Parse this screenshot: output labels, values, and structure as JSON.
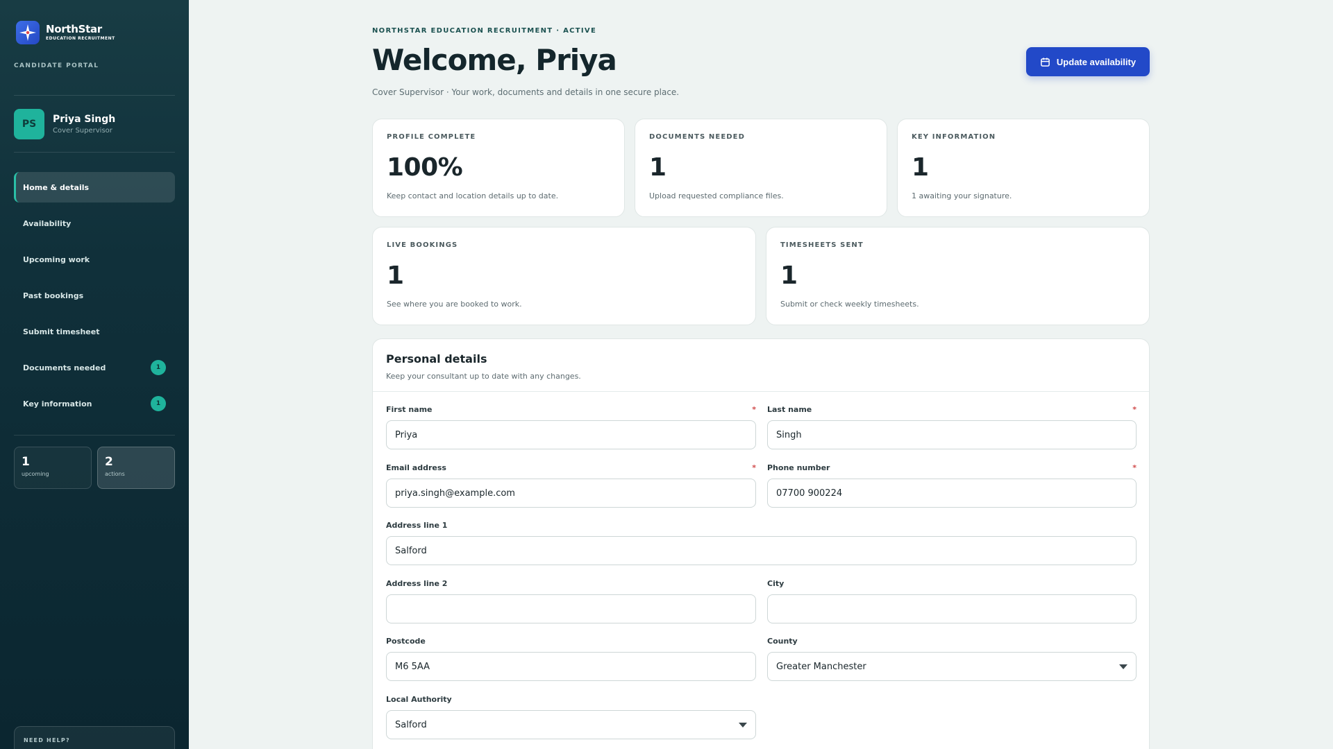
{
  "brand": {
    "name": "NorthStar",
    "sub": "EDUCATION RECRUITMENT"
  },
  "sidebar": {
    "portal_label": "CANDIDATE PORTAL",
    "profile": {
      "initials": "PS",
      "name": "Priya Singh",
      "role": "Cover Supervisor"
    },
    "nav": [
      {
        "label": "Home & details",
        "active": true,
        "badge": ""
      },
      {
        "label": "Availability",
        "badge": ""
      },
      {
        "label": "Upcoming work",
        "badge": ""
      },
      {
        "label": "Past bookings",
        "badge": ""
      },
      {
        "label": "Submit timesheet",
        "badge": ""
      },
      {
        "label": "Documents needed",
        "badge": "1"
      },
      {
        "label": "Key information",
        "badge": "1"
      }
    ],
    "stats": [
      {
        "value": "1",
        "label": "upcoming"
      },
      {
        "value": "2",
        "label": "actions"
      }
    ],
    "help_label": "NEED HELP?"
  },
  "header": {
    "eyebrow": "NORTHSTAR EDUCATION RECRUITMENT · ACTIVE",
    "title": "Welcome, Priya",
    "subtitle": "Cover Supervisor · Your work, documents and details in one secure place.",
    "cta_label": "Update availability"
  },
  "cards": [
    {
      "label": "PROFILE COMPLETE",
      "value": "100%",
      "desc": "Keep contact and location details up to date."
    },
    {
      "label": "DOCUMENTS NEEDED",
      "value": "1",
      "desc": "Upload requested compliance files."
    },
    {
      "label": "KEY INFORMATION",
      "value": "1",
      "desc": "1 awaiting your signature."
    },
    {
      "label": "LIVE BOOKINGS",
      "value": "1",
      "desc": "See where you are booked to work."
    },
    {
      "label": "TIMESHEETS SENT",
      "value": "1",
      "desc": "Submit or check weekly timesheets."
    }
  ],
  "personal": {
    "title": "Personal details",
    "subtitle": "Keep your consultant up to date with any changes.",
    "required_mark": "*",
    "fields": {
      "first_name": {
        "label": "First name",
        "value": "Priya"
      },
      "last_name": {
        "label": "Last name",
        "value": "Singh"
      },
      "email": {
        "label": "Email address",
        "value": "priya.singh@example.com"
      },
      "phone": {
        "label": "Phone number",
        "value": "07700 900224"
      },
      "address1": {
        "label": "Address line 1",
        "value": "Salford"
      },
      "address2": {
        "label": "Address line 2",
        "value": ""
      },
      "city": {
        "label": "City",
        "value": ""
      },
      "postcode": {
        "label": "Postcode",
        "value": "M6 5AA"
      },
      "county": {
        "label": "County",
        "value": "Greater Manchester"
      },
      "local_authority": {
        "label": "Local Authority",
        "value": "Salford"
      }
    }
  },
  "colors": {
    "accent": "#2249c8",
    "teal": "#1fb39c",
    "sidebar": "#10303a"
  }
}
